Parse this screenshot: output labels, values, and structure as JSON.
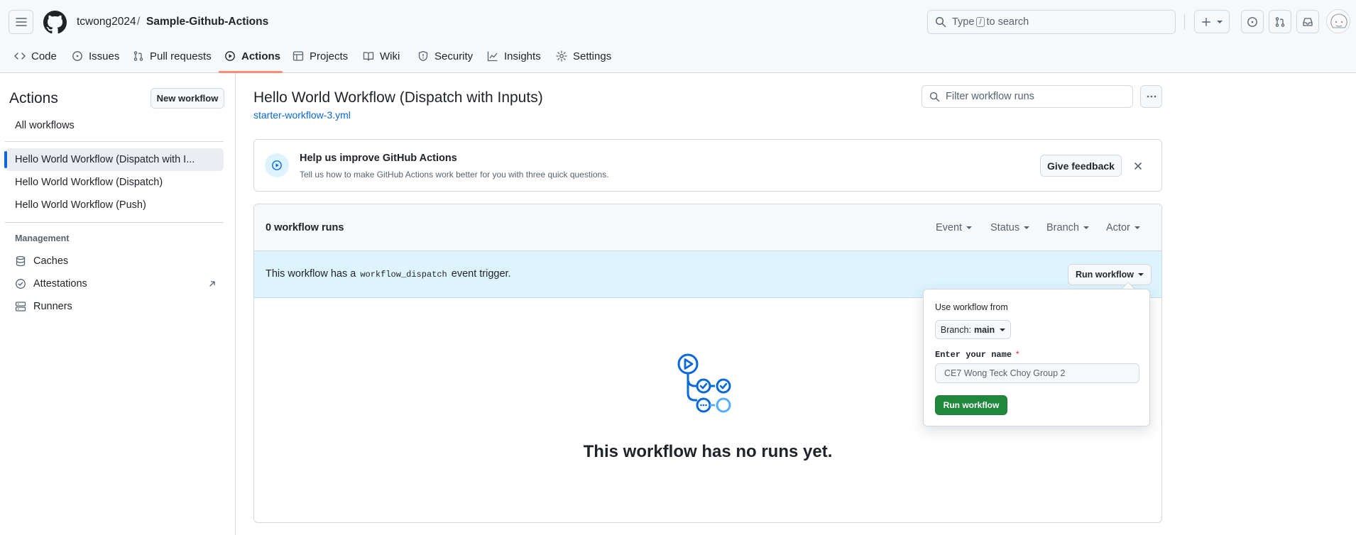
{
  "header": {
    "owner": "tcwong2024",
    "separator": "/",
    "repo": "Sample-Github-Actions",
    "search_prefix": "Type",
    "search_key": "/",
    "search_suffix": "to search"
  },
  "tabs": [
    {
      "label": "Code",
      "icon": "code-icon"
    },
    {
      "label": "Issues",
      "icon": "issue-icon"
    },
    {
      "label": "Pull requests",
      "icon": "pull-request-icon"
    },
    {
      "label": "Actions",
      "icon": "play-icon",
      "active": true
    },
    {
      "label": "Projects",
      "icon": "table-icon"
    },
    {
      "label": "Wiki",
      "icon": "book-icon"
    },
    {
      "label": "Security",
      "icon": "shield-icon"
    },
    {
      "label": "Insights",
      "icon": "graph-icon"
    },
    {
      "label": "Settings",
      "icon": "gear-icon"
    }
  ],
  "sidebar": {
    "title": "Actions",
    "new_workflow": "New workflow",
    "all_workflows": "All workflows",
    "workflows": [
      {
        "label": "Hello World Workflow (Dispatch with I...",
        "active": true
      },
      {
        "label": "Hello World Workflow (Dispatch)"
      },
      {
        "label": "Hello World Workflow (Push)"
      }
    ],
    "management_heading": "Management",
    "management": [
      {
        "label": "Caches",
        "icon": "database-icon"
      },
      {
        "label": "Attestations",
        "icon": "verified-icon"
      },
      {
        "label": "Runners",
        "icon": "server-icon"
      }
    ]
  },
  "main": {
    "title": "Hello World Workflow (Dispatch with Inputs)",
    "file": "starter-workflow-3.yml",
    "filter_placeholder": "Filter workflow runs"
  },
  "feedback": {
    "title": "Help us improve GitHub Actions",
    "subtitle": "Tell us how to make GitHub Actions work better for you with three quick questions.",
    "button": "Give feedback"
  },
  "runs": {
    "count_label": "0 workflow runs",
    "filters": [
      "Event",
      "Status",
      "Branch",
      "Actor"
    ],
    "dispatch_prefix": "This workflow has a",
    "dispatch_code": "workflow_dispatch",
    "dispatch_suffix": "event trigger.",
    "run_workflow": "Run workflow",
    "empty_title": "This workflow has no runs yet."
  },
  "popover": {
    "use_from": "Use workflow from",
    "branch_prefix": "Branch:",
    "branch_value": "main",
    "input_label": "Enter your name",
    "required_mark": "*",
    "input_value": "CE7 Wong Teck Choy Group 2",
    "run_button": "Run workflow"
  },
  "colors": {
    "accent_blue": "#0969da",
    "green": "#1f883d",
    "tab_underline": "#fd8c73",
    "dispatch_bg": "#ddf4ff"
  }
}
